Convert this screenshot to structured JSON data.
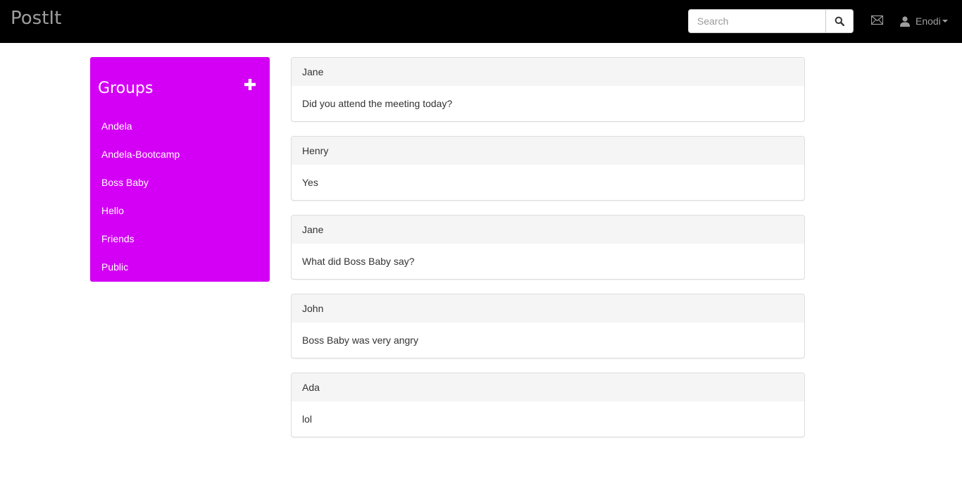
{
  "navbar": {
    "brand": "PostIt",
    "search": {
      "placeholder": "Search",
      "value": ""
    },
    "search_button_icon": "search-icon",
    "mail_icon": "envelope-icon",
    "user": {
      "icon": "user-icon",
      "name": "Enodi"
    }
  },
  "sidebar": {
    "title": "Groups",
    "add_icon": "plus-icon",
    "groups": [
      {
        "label": "Andela"
      },
      {
        "label": "Andela-Bootcamp"
      },
      {
        "label": "Boss Baby"
      },
      {
        "label": "Hello"
      },
      {
        "label": "Friends"
      },
      {
        "label": "Public"
      }
    ]
  },
  "messages": [
    {
      "author": "Jane",
      "text": "Did you attend the meeting today?"
    },
    {
      "author": "Henry",
      "text": "Yes"
    },
    {
      "author": "Jane",
      "text": "What did Boss Baby say?"
    },
    {
      "author": "John",
      "text": "Boss Baby was very angry"
    },
    {
      "author": "Ada",
      "text": "lol"
    }
  ],
  "colors": {
    "navbar_bg": "#000000",
    "sidebar_bg": "#d400f5",
    "panel_heading_bg": "#f5f5f5",
    "muted_text": "#9d9d9d"
  }
}
